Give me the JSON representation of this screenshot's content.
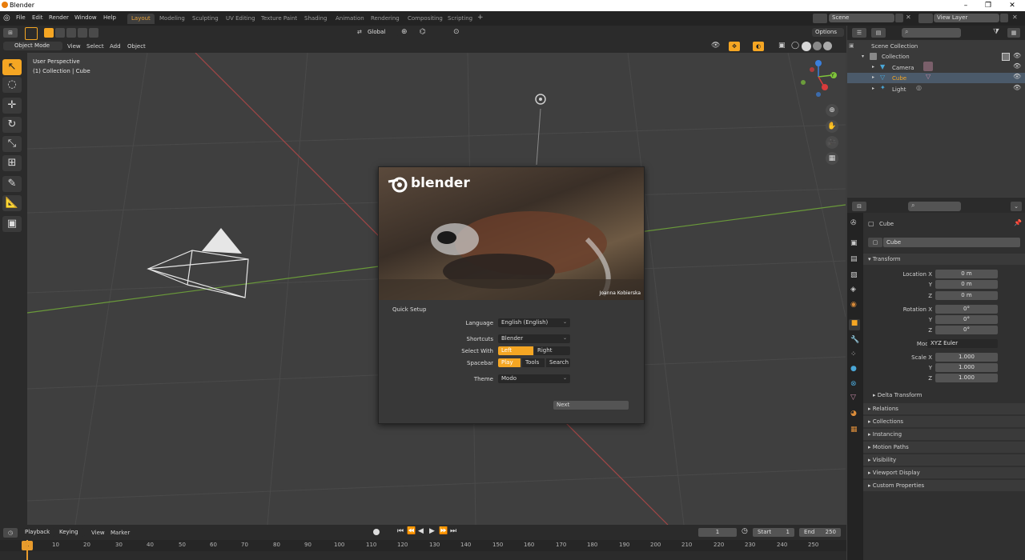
{
  "window": {
    "title": "Blender"
  },
  "menu": [
    "File",
    "Edit",
    "Render",
    "Window",
    "Help"
  ],
  "workspaces": [
    "Layout",
    "Modeling",
    "Sculpting",
    "UV Editing",
    "Texture Paint",
    "Shading",
    "Animation",
    "Rendering",
    "Compositing",
    "Scripting"
  ],
  "active_workspace": "Layout",
  "add_workspace": "+",
  "scene": {
    "label": "Scene"
  },
  "view_layer": {
    "label": "View Layer"
  },
  "viewport_header": {
    "orientation": "Global",
    "options": "Options",
    "mode": "Object Mode",
    "menu": [
      "View",
      "Select",
      "Add",
      "Object"
    ]
  },
  "viewport": {
    "perspective": "User Perspective",
    "collection_info": "(1) Collection | Cube",
    "gizmo_axes": [
      "X",
      "Y",
      "Z"
    ]
  },
  "splash": {
    "brand": "blender",
    "credit": "Joanna Kobierska",
    "heading": "Quick Setup",
    "language_label": "Language",
    "language_value": "English (English)",
    "shortcuts_label": "Shortcuts",
    "shortcuts_value": "Blender",
    "select_with_label": "Select With",
    "select_left": "Left",
    "select_right": "Right",
    "spacebar_label": "Spacebar",
    "spacebar_play": "Play",
    "spacebar_tools": "Tools",
    "spacebar_search": "Search",
    "theme_label": "Theme",
    "theme_value": "Modo",
    "next_button": "Next"
  },
  "outliner": {
    "scene_collection": "Scene Collection",
    "collection": "Collection",
    "items": [
      "Camera",
      "Cube",
      "Light"
    ]
  },
  "properties": {
    "object_name": "Cube",
    "object_field": "Cube",
    "transform": "Transform",
    "location_label": "Location X",
    "rotation_label": "Rotation X",
    "scale_label": "Scale X",
    "y_label": "Y",
    "z_label": "Z",
    "location": [
      "0 m",
      "0 m",
      "0 m"
    ],
    "rotation": [
      "0°",
      "0°",
      "0°"
    ],
    "mode_label": "Mode",
    "mode_value": "XYZ Euler",
    "scale": [
      "1.000",
      "1.000",
      "1.000"
    ],
    "delta_transform": "Delta Transform",
    "panels": [
      "Relations",
      "Collections",
      "Instancing",
      "Motion Paths",
      "Visibility",
      "Viewport Display",
      "Custom Properties"
    ]
  },
  "timeline": {
    "playback": "Playback",
    "keying": "Keying",
    "view": "View",
    "marker": "Marker",
    "current_frame": "1",
    "start_label": "Start",
    "start_value": "1",
    "end_label": "End",
    "end_value": "250",
    "ruler": [
      "1",
      "10",
      "20",
      "30",
      "40",
      "50",
      "60",
      "70",
      "80",
      "90",
      "100",
      "110",
      "120",
      "130",
      "140",
      "150",
      "160",
      "170",
      "180",
      "190",
      "200",
      "210",
      "220",
      "230",
      "240",
      "250"
    ]
  },
  "colors": {
    "accent": "#f5a623",
    "x_axis": "#d93b3b",
    "y_axis": "#7fc43b",
    "z_axis": "#3a7fdc"
  }
}
